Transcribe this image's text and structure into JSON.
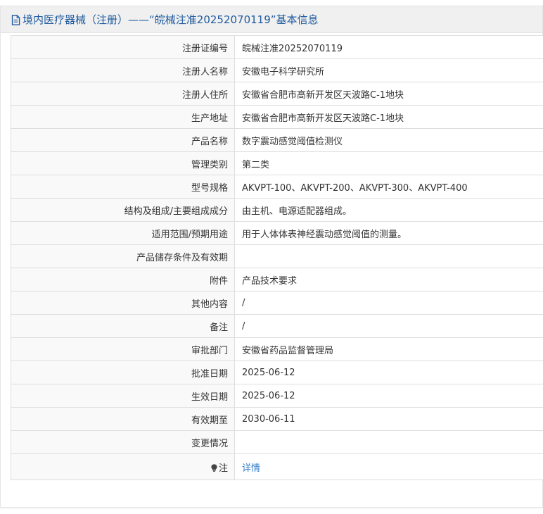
{
  "header": {
    "icon": "document-icon",
    "title": "境内医疗器械（注册）——“皖械注准20252070119”基本信息"
  },
  "rows": [
    {
      "label": "注册证编号",
      "value": "皖械注准20252070119"
    },
    {
      "label": "注册人名称",
      "value": "安徽电子科学研究所"
    },
    {
      "label": "注册人住所",
      "value": "安徽省合肥市高新开发区天波路C-1地块"
    },
    {
      "label": "生产地址",
      "value": "安徽省合肥市高新开发区天波路C-1地块"
    },
    {
      "label": "产品名称",
      "value": "数字震动感觉阈值检测仪"
    },
    {
      "label": "管理类别",
      "value": "第二类"
    },
    {
      "label": "型号规格",
      "value": "AKVPT-100、AKVPT-200、AKVPT-300、AKVPT-400"
    },
    {
      "label": "结构及组成/主要组成成分",
      "value": "由主机、电源适配器组成。"
    },
    {
      "label": "适用范围/预期用途",
      "value": "用于人体体表神经震动感觉阈值的测量。"
    },
    {
      "label": "产品储存条件及有效期",
      "value": ""
    },
    {
      "label": "附件",
      "value": "产品技术要求"
    },
    {
      "label": "其他内容",
      "value": "/"
    },
    {
      "label": "备注",
      "value": "/"
    },
    {
      "label": "审批部门",
      "value": "安徽省药品监督管理局"
    },
    {
      "label": "批准日期",
      "value": "2025-06-12"
    },
    {
      "label": "生效日期",
      "value": "2025-06-12"
    },
    {
      "label": "有效期至",
      "value": "2030-06-11"
    },
    {
      "label": "变更情况",
      "value": ""
    }
  ],
  "note_row": {
    "icon": "lightbulb-icon",
    "label": "注",
    "link_label": "详情"
  },
  "colors": {
    "title": "#1e5a9e",
    "link": "#2b7bc8",
    "header_bg": "#f0f0f0",
    "label_bg": "#f9f9f9",
    "border": "#dedede"
  }
}
